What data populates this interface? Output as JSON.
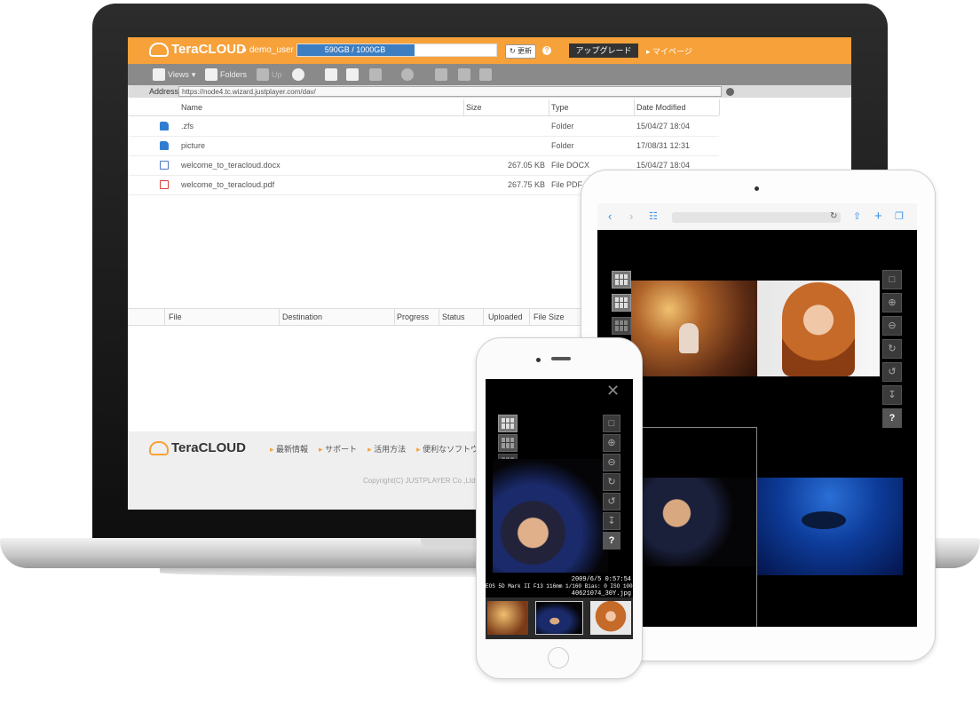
{
  "header": {
    "logo": "TeraCLOUD",
    "user": "demo_user",
    "quota_text": "590GB / 1000GB",
    "quota_fraction": 0.59,
    "refresh_label": "更新",
    "help_label": "?",
    "upgrade_label": "アップグレード",
    "mypage_label": "マイページ"
  },
  "toolbar": {
    "views_label": "Views",
    "folders_label": "Folders",
    "up_label": "Up"
  },
  "address": {
    "label": "Address:",
    "value": "https://node4.tc.wizard.justplayer.com/dav/"
  },
  "file_columns": {
    "name": "Name",
    "size": "Size",
    "type": "Type",
    "modified": "Date Modified"
  },
  "files": [
    {
      "icon": "folder-icon",
      "name": ".zfs",
      "size": "",
      "type": "Folder",
      "modified": "15/04/27 18:04"
    },
    {
      "icon": "folder-icon",
      "name": "picture",
      "size": "",
      "type": "Folder",
      "modified": "17/08/31 12:31"
    },
    {
      "icon": "docx-file-icon",
      "name": "welcome_to_teracloud.docx",
      "size": "267.05 KB",
      "type": "File DOCX",
      "modified": "15/04/27 18:04"
    },
    {
      "icon": "pdf-file-icon",
      "name": "welcome_to_teracloud.pdf",
      "size": "267.75 KB",
      "type": "File PDF",
      "modified": ""
    }
  ],
  "transfer_columns": {
    "file": "File",
    "destination": "Destination",
    "progress": "Progress",
    "status": "Status",
    "uploaded": "Uploaded",
    "filesize": "File Size"
  },
  "footer": {
    "logo": "TeraCLOUD",
    "links": [
      "最新情報",
      "サポート",
      "活用方法",
      "便利なソフトウエア"
    ],
    "copyright": "Copyright(C) JUSTPLAYER Co.,Ltd."
  },
  "tablet": {
    "help_label": "?"
  },
  "phone": {
    "help_label": "?",
    "exif_line1": "2009/6/5 0:57:54",
    "exif_line2": "EOS 5D Mark II F13 116mm 1/160 Bias: 0 ISO 100",
    "exif_line3": "40621074_30Y.jpg"
  },
  "colors": {
    "brand": "#f7a13a",
    "quota_fill": "#3d7ec2",
    "toolbar": "#8a8a8a"
  }
}
